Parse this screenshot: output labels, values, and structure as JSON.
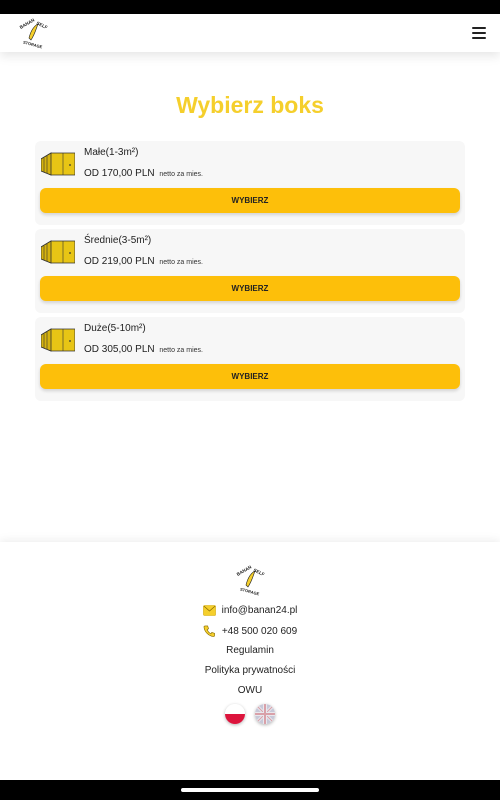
{
  "header": {
    "logo_text_top": "BANAN SELF",
    "logo_text_bottom": "STORAGE",
    "menu_icon": "hamburger-menu-icon"
  },
  "main": {
    "title": "Wybierz boks",
    "boxes": [
      {
        "name": "Małe(1-3m²)",
        "price": "OD 170,00 PLN",
        "price_note": "netto za mies.",
        "button": "WYBIERZ"
      },
      {
        "name": "Średnie(3-5m²)",
        "price": "OD 219,00 PLN",
        "price_note": "netto za mies.",
        "button": "WYBIERZ"
      },
      {
        "name": "Duże(5-10m²)",
        "price": "OD 305,00 PLN",
        "price_note": "netto za mies.",
        "button": "WYBIERZ"
      }
    ]
  },
  "footer": {
    "email": "info@banan24.pl",
    "phone": "+48 500 020 609",
    "links": [
      "Regulamin",
      "Polityka prywatności",
      "OWU"
    ],
    "languages": [
      "pl-flag-icon",
      "uk-flag-icon"
    ]
  },
  "colors": {
    "accent_title": "#f5cf2c",
    "button": "#fdbf0a",
    "card_bg": "#f7f7f7"
  }
}
